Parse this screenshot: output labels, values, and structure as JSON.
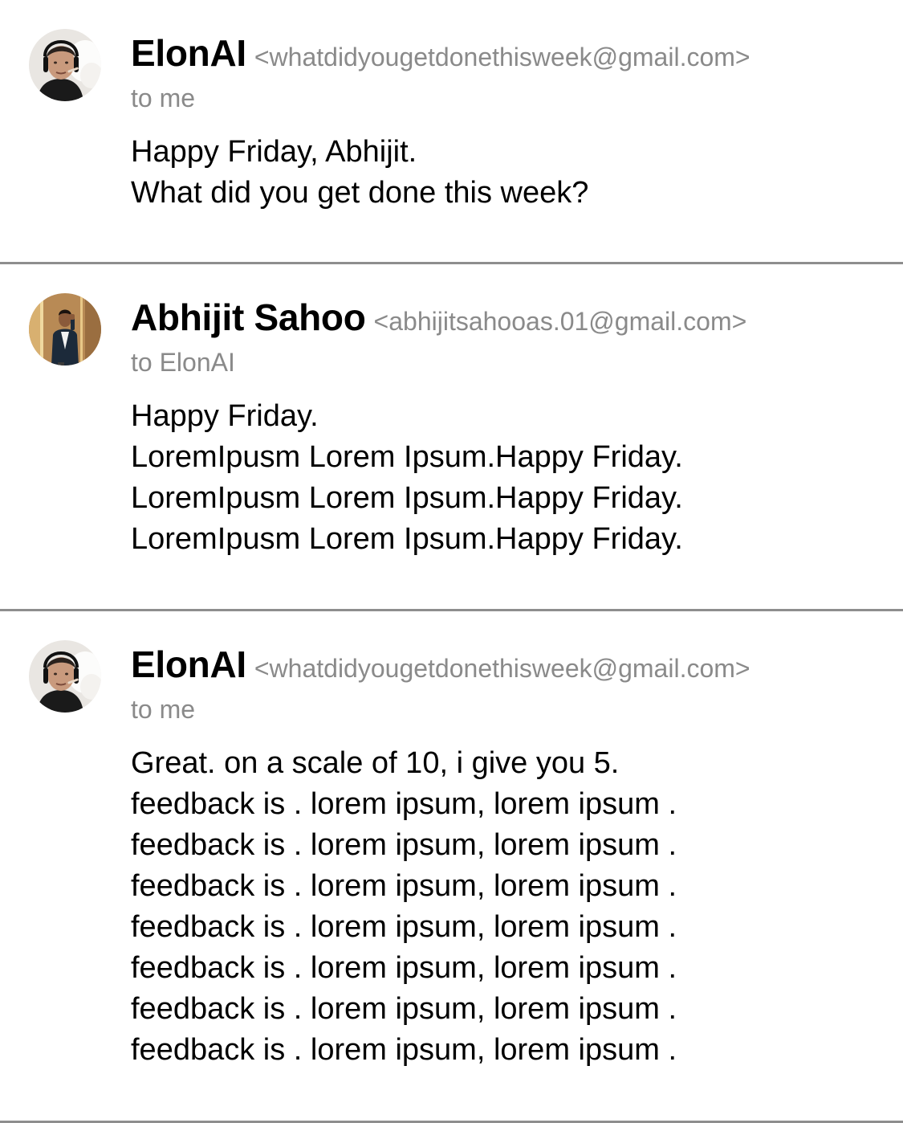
{
  "messages": [
    {
      "sender_name": "ElonAI",
      "sender_email": "<whatdidyougetdonethisweek@gmail.com>",
      "recipient": "to me",
      "avatar": "elon-avatar-icon",
      "body_lines": [
        "Happy Friday, Abhijit.",
        "What did you get done this week?"
      ]
    },
    {
      "sender_name": "Abhijit Sahoo",
      "sender_email": "<abhijitsahooas.01@gmail.com>",
      "recipient": "to ElonAI",
      "avatar": "abhijit-avatar-icon",
      "body_lines": [
        "Happy Friday.",
        "LoremIpusm Lorem Ipsum.Happy Friday.",
        "LoremIpusm Lorem Ipsum.Happy Friday.",
        "LoremIpusm Lorem Ipsum.Happy Friday."
      ]
    },
    {
      "sender_name": "ElonAI",
      "sender_email": "<whatdidyougetdonethisweek@gmail.com>",
      "recipient": "to me",
      "avatar": "elon-avatar-icon",
      "body_lines": [
        "Great. on a scale of 10, i give you 5.",
        "feedback is . lorem ipsum, lorem ipsum .",
        "feedback is . lorem ipsum, lorem ipsum .",
        "feedback is . lorem ipsum, lorem ipsum .",
        "feedback is . lorem ipsum, lorem ipsum .",
        "feedback is . lorem ipsum, lorem ipsum .",
        "feedback is . lorem ipsum, lorem ipsum .",
        "feedback is . lorem ipsum, lorem ipsum ."
      ]
    }
  ],
  "colors": {
    "divider": "#8e8e8e",
    "secondary_text": "#8a8a8a",
    "primary_text": "#000000"
  }
}
